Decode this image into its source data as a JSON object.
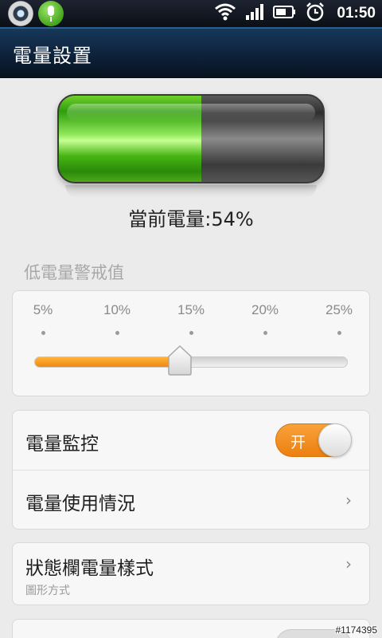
{
  "status_bar": {
    "time": "01:50",
    "icons": [
      "camera-app-icon",
      "voice-mic-icon",
      "wifi-icon",
      "signal-icon",
      "battery-icon",
      "alarm-icon"
    ]
  },
  "header": {
    "title": "電量設置"
  },
  "battery": {
    "level_percent": 54,
    "label": "當前電量:54%",
    "fill_color": "#48b414"
  },
  "low_battery": {
    "section_label": "低電量警戒值",
    "ticks": [
      "5%",
      "10%",
      "15%",
      "20%",
      "25%"
    ],
    "selected": "15%",
    "selected_fraction": 0.5,
    "accent_color": "#f08a10"
  },
  "settings": {
    "monitor": {
      "label": "電量監控",
      "toggle_text": "开",
      "enabled": true
    },
    "usage": {
      "label": "電量使用情況"
    },
    "status_style": {
      "label": "狀態欄電量樣式",
      "sub_label": "圖形方式"
    }
  },
  "watermark": "#1174395"
}
